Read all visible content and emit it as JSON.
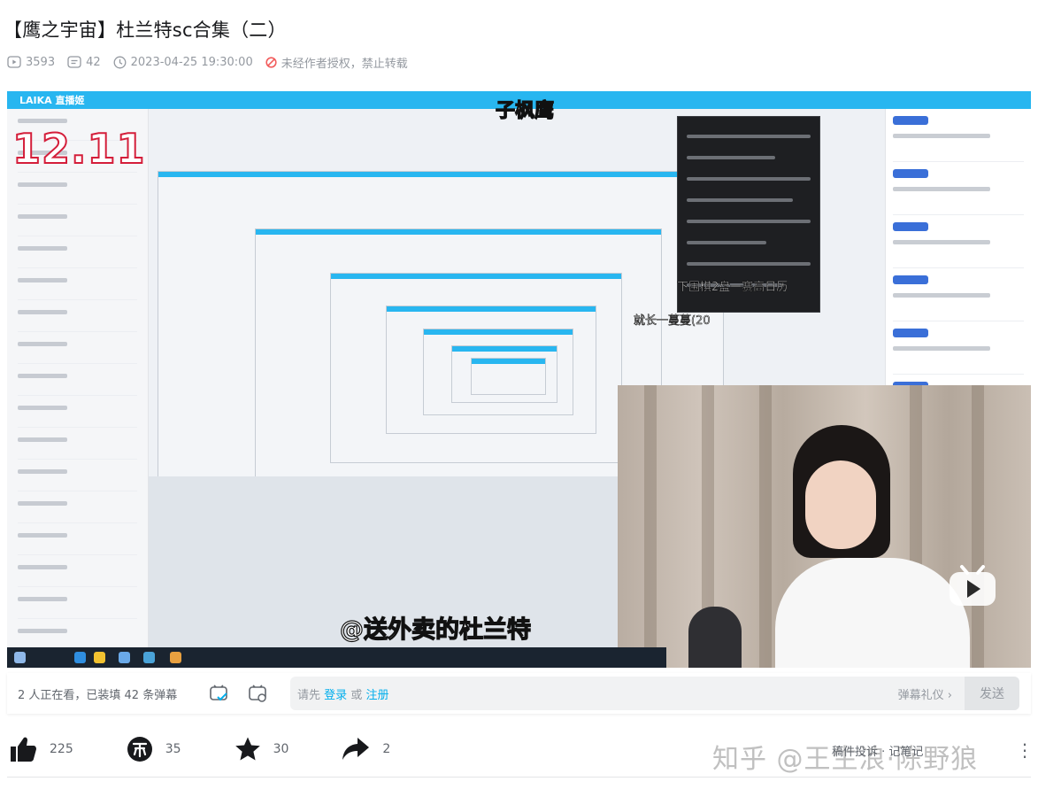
{
  "video": {
    "title": "【鹰之宇宙】杜兰特sc合集（二）",
    "plays": "3593",
    "danmaku_count": "42",
    "datetime": "2023-04-25 19:30:00",
    "copyright": "未经作者授权，禁止转载"
  },
  "player": {
    "caption_top": "子枫鹰",
    "big_number": "12.11",
    "caption_bottom": "@送外卖的杜兰特",
    "overlay_text_1": "下围棋2盘一赛高日历",
    "overlay_text_2": "就长一蔓蔓(20"
  },
  "danmaku_bar": {
    "viewers": "2 人正在看，已装填 42 条弹幕",
    "hint_prefix": "请先",
    "login": "登录",
    "or": "或",
    "register": "注册",
    "etiquette": "弹幕礼仪 ›",
    "send": "发送"
  },
  "actions": {
    "like": "225",
    "coin": "35",
    "favorite": "30",
    "share": "2"
  },
  "footer": {
    "watermark": "知乎 @王生浪·陈野狼",
    "links": "稿件投诉 · 记笔记"
  },
  "colors": {
    "accent": "#00aeec",
    "icon": "#18191c",
    "muted": "#9499a0",
    "live_blue": "#28b6f0"
  }
}
